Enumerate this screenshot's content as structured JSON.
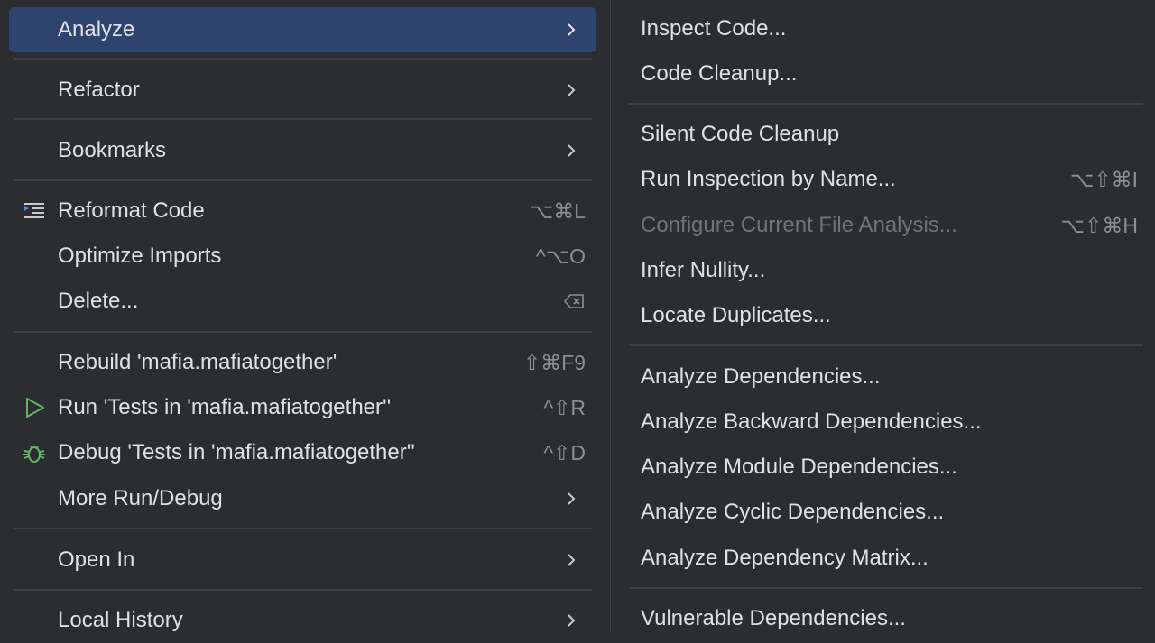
{
  "left_menu": {
    "items": [
      {
        "label": "Analyze"
      },
      {
        "label": "Refactor"
      },
      {
        "label": "Bookmarks"
      },
      {
        "label": "Reformat Code",
        "shortcut": "⌥⌘L"
      },
      {
        "label": "Optimize Imports",
        "shortcut": "^⌥O"
      },
      {
        "label": "Delete..."
      },
      {
        "label": "Rebuild 'mafia.mafiatogether'",
        "shortcut": "⇧⌘F9"
      },
      {
        "label": "Run 'Tests in 'mafia.mafiatogether''",
        "shortcut": "^⇧R"
      },
      {
        "label": "Debug 'Tests in 'mafia.mafiatogether''",
        "shortcut": "^⇧D"
      },
      {
        "label": "More Run/Debug"
      },
      {
        "label": "Open In"
      },
      {
        "label": "Local History"
      }
    ]
  },
  "right_menu": {
    "items": [
      {
        "label": "Inspect Code..."
      },
      {
        "label": "Code Cleanup..."
      },
      {
        "label": "Silent Code Cleanup"
      },
      {
        "label": "Run Inspection by Name...",
        "shortcut": "⌥⇧⌘I"
      },
      {
        "label": "Configure Current File Analysis...",
        "shortcut": "⌥⇧⌘H"
      },
      {
        "label": "Infer Nullity..."
      },
      {
        "label": "Locate Duplicates..."
      },
      {
        "label": "Analyze Dependencies..."
      },
      {
        "label": "Analyze Backward Dependencies..."
      },
      {
        "label": "Analyze Module Dependencies..."
      },
      {
        "label": "Analyze Cyclic Dependencies..."
      },
      {
        "label": "Analyze Dependency Matrix..."
      },
      {
        "label": "Vulnerable Dependencies..."
      }
    ]
  },
  "colors": {
    "background": "#2b2d30",
    "selection": "#2e436e",
    "text": "#dfe1e5",
    "shortcut_text": "#8c8f94",
    "disabled_text": "#6f737a",
    "run_icon": "#5fb865"
  }
}
